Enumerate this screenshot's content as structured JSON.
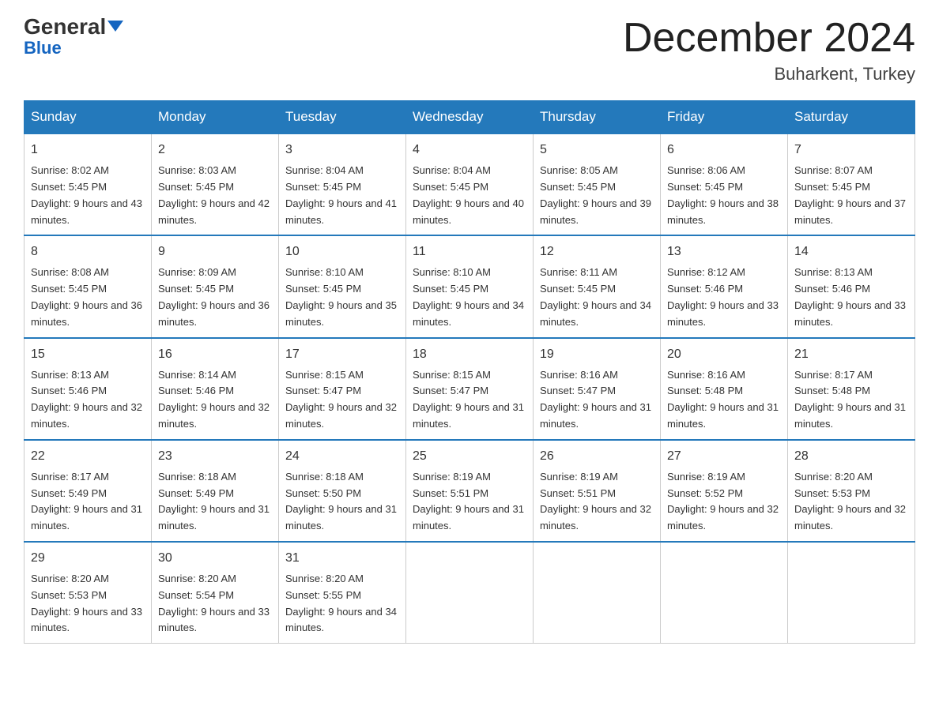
{
  "logo": {
    "general": "General",
    "blue": "Blue",
    "triangle": "▲"
  },
  "header": {
    "month_year": "December 2024",
    "location": "Buharkent, Turkey"
  },
  "weekdays": [
    "Sunday",
    "Monday",
    "Tuesday",
    "Wednesday",
    "Thursday",
    "Friday",
    "Saturday"
  ],
  "weeks": [
    [
      {
        "day": "1",
        "sunrise": "8:02 AM",
        "sunset": "5:45 PM",
        "daylight": "9 hours and 43 minutes."
      },
      {
        "day": "2",
        "sunrise": "8:03 AM",
        "sunset": "5:45 PM",
        "daylight": "9 hours and 42 minutes."
      },
      {
        "day": "3",
        "sunrise": "8:04 AM",
        "sunset": "5:45 PM",
        "daylight": "9 hours and 41 minutes."
      },
      {
        "day": "4",
        "sunrise": "8:04 AM",
        "sunset": "5:45 PM",
        "daylight": "9 hours and 40 minutes."
      },
      {
        "day": "5",
        "sunrise": "8:05 AM",
        "sunset": "5:45 PM",
        "daylight": "9 hours and 39 minutes."
      },
      {
        "day": "6",
        "sunrise": "8:06 AM",
        "sunset": "5:45 PM",
        "daylight": "9 hours and 38 minutes."
      },
      {
        "day": "7",
        "sunrise": "8:07 AM",
        "sunset": "5:45 PM",
        "daylight": "9 hours and 37 minutes."
      }
    ],
    [
      {
        "day": "8",
        "sunrise": "8:08 AM",
        "sunset": "5:45 PM",
        "daylight": "9 hours and 36 minutes."
      },
      {
        "day": "9",
        "sunrise": "8:09 AM",
        "sunset": "5:45 PM",
        "daylight": "9 hours and 36 minutes."
      },
      {
        "day": "10",
        "sunrise": "8:10 AM",
        "sunset": "5:45 PM",
        "daylight": "9 hours and 35 minutes."
      },
      {
        "day": "11",
        "sunrise": "8:10 AM",
        "sunset": "5:45 PM",
        "daylight": "9 hours and 34 minutes."
      },
      {
        "day": "12",
        "sunrise": "8:11 AM",
        "sunset": "5:45 PM",
        "daylight": "9 hours and 34 minutes."
      },
      {
        "day": "13",
        "sunrise": "8:12 AM",
        "sunset": "5:46 PM",
        "daylight": "9 hours and 33 minutes."
      },
      {
        "day": "14",
        "sunrise": "8:13 AM",
        "sunset": "5:46 PM",
        "daylight": "9 hours and 33 minutes."
      }
    ],
    [
      {
        "day": "15",
        "sunrise": "8:13 AM",
        "sunset": "5:46 PM",
        "daylight": "9 hours and 32 minutes."
      },
      {
        "day": "16",
        "sunrise": "8:14 AM",
        "sunset": "5:46 PM",
        "daylight": "9 hours and 32 minutes."
      },
      {
        "day": "17",
        "sunrise": "8:15 AM",
        "sunset": "5:47 PM",
        "daylight": "9 hours and 32 minutes."
      },
      {
        "day": "18",
        "sunrise": "8:15 AM",
        "sunset": "5:47 PM",
        "daylight": "9 hours and 31 minutes."
      },
      {
        "day": "19",
        "sunrise": "8:16 AM",
        "sunset": "5:47 PM",
        "daylight": "9 hours and 31 minutes."
      },
      {
        "day": "20",
        "sunrise": "8:16 AM",
        "sunset": "5:48 PM",
        "daylight": "9 hours and 31 minutes."
      },
      {
        "day": "21",
        "sunrise": "8:17 AM",
        "sunset": "5:48 PM",
        "daylight": "9 hours and 31 minutes."
      }
    ],
    [
      {
        "day": "22",
        "sunrise": "8:17 AM",
        "sunset": "5:49 PM",
        "daylight": "9 hours and 31 minutes."
      },
      {
        "day": "23",
        "sunrise": "8:18 AM",
        "sunset": "5:49 PM",
        "daylight": "9 hours and 31 minutes."
      },
      {
        "day": "24",
        "sunrise": "8:18 AM",
        "sunset": "5:50 PM",
        "daylight": "9 hours and 31 minutes."
      },
      {
        "day": "25",
        "sunrise": "8:19 AM",
        "sunset": "5:51 PM",
        "daylight": "9 hours and 31 minutes."
      },
      {
        "day": "26",
        "sunrise": "8:19 AM",
        "sunset": "5:51 PM",
        "daylight": "9 hours and 32 minutes."
      },
      {
        "day": "27",
        "sunrise": "8:19 AM",
        "sunset": "5:52 PM",
        "daylight": "9 hours and 32 minutes."
      },
      {
        "day": "28",
        "sunrise": "8:20 AM",
        "sunset": "5:53 PM",
        "daylight": "9 hours and 32 minutes."
      }
    ],
    [
      {
        "day": "29",
        "sunrise": "8:20 AM",
        "sunset": "5:53 PM",
        "daylight": "9 hours and 33 minutes."
      },
      {
        "day": "30",
        "sunrise": "8:20 AM",
        "sunset": "5:54 PM",
        "daylight": "9 hours and 33 minutes."
      },
      {
        "day": "31",
        "sunrise": "8:20 AM",
        "sunset": "5:55 PM",
        "daylight": "9 hours and 34 minutes."
      },
      null,
      null,
      null,
      null
    ]
  ]
}
